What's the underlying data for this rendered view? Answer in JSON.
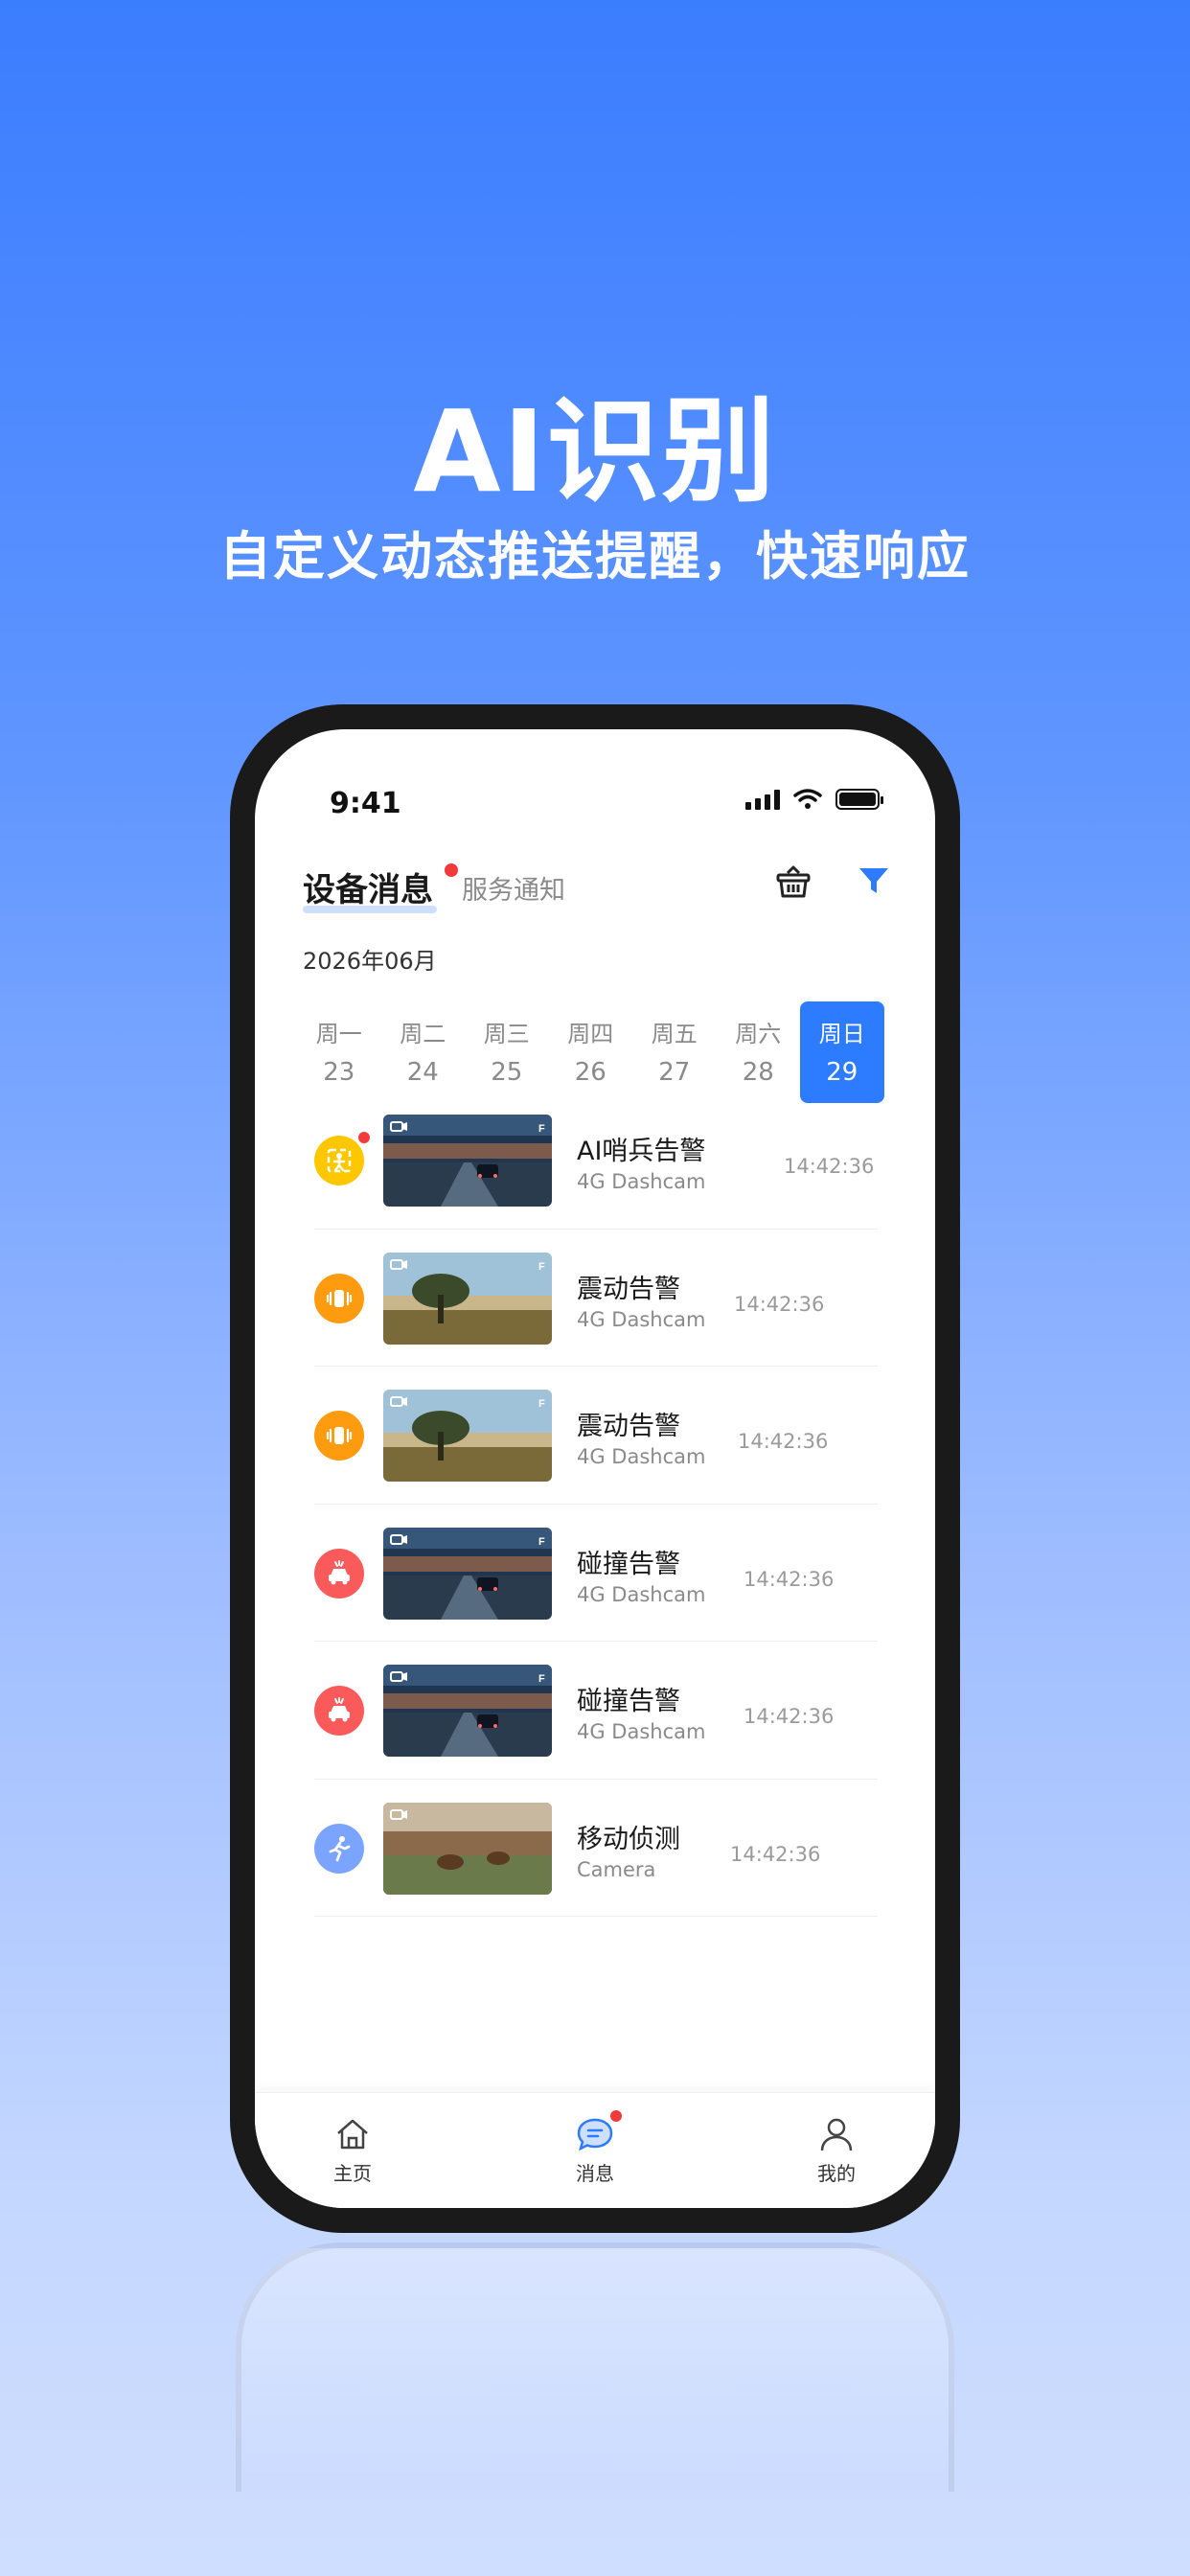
{
  "hero": {
    "title": "AI识别",
    "subtitle": "自定义动态推送提醒，快速响应"
  },
  "status_bar": {
    "time": "9:41"
  },
  "header": {
    "tab_device": "设备消息",
    "tab_service": "服务通知",
    "month": "2026年06月"
  },
  "week": [
    {
      "name": "周一",
      "date": "23"
    },
    {
      "name": "周二",
      "date": "24"
    },
    {
      "name": "周三",
      "date": "25"
    },
    {
      "name": "周四",
      "date": "26"
    },
    {
      "name": "周五",
      "date": "27"
    },
    {
      "name": "周六",
      "date": "28"
    },
    {
      "name": "周日",
      "date": "29"
    }
  ],
  "messages": [
    {
      "title": "AI哨兵告警",
      "device": "4G Dashcam",
      "time": "14:42:36",
      "icon": "ai-sentry-icon",
      "color": "#ffc700",
      "unread": true
    },
    {
      "title": "震动告警",
      "device": "4G Dashcam",
      "time": "14:42:36",
      "icon": "vibration-icon",
      "color": "#ff9b0f",
      "unread": false
    },
    {
      "title": "震动告警",
      "device": "4G Dashcam",
      "time": "14:42:36",
      "icon": "vibration-icon",
      "color": "#ff9b0f",
      "unread": false
    },
    {
      "title": "碰撞告警",
      "device": "4G Dashcam",
      "time": "14:42:36",
      "icon": "collision-icon",
      "color": "#fa5a5a",
      "unread": false
    },
    {
      "title": "碰撞告警",
      "device": "4G Dashcam",
      "time": "14:42:36",
      "icon": "collision-icon",
      "color": "#fa5a5a",
      "unread": false
    },
    {
      "title": "移动侦测",
      "device": "Camera",
      "time": "14:42:36",
      "icon": "motion-icon",
      "color": "#7aa4ff",
      "unread": false
    }
  ],
  "nav": {
    "home": "主页",
    "messages": "消息",
    "mine": "我的"
  },
  "colors": {
    "accent": "#2d7bff",
    "badge": "#f23a3a"
  }
}
